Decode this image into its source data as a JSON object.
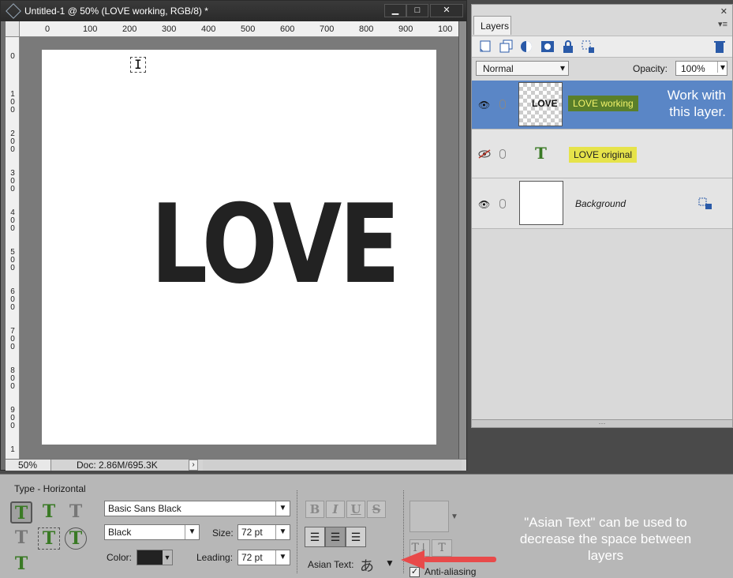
{
  "document": {
    "title": "Untitled-1 @ 50% (LOVE working, RGB/8) *",
    "canvas_text": "LOVE",
    "window_buttons": [
      "▁",
      "□",
      "✕"
    ],
    "ruler_h": [
      "0",
      "100",
      "200",
      "300",
      "400",
      "500",
      "600",
      "700",
      "800",
      "900",
      "100"
    ],
    "ruler_v": [
      "0",
      "1\n0\n0",
      "2\n0\n0",
      "3\n0\n0",
      "4\n0\n0",
      "5\n0\n0",
      "6\n0\n0",
      "7\n0\n0",
      "8\n0\n0",
      "9\n0\n0",
      "1"
    ],
    "status": {
      "zoom": "50%",
      "doc_info": "Doc: 2.86M/695.3K",
      "arrow": "›"
    }
  },
  "layers_panel": {
    "tab": "Layers",
    "blend_mode": "Normal",
    "opacity_label": "Opacity:",
    "opacity_value": "100%",
    "layers": [
      {
        "name": "LOVE working",
        "thumb_text": "LOVE",
        "note": "Work with this layer.",
        "visible": true,
        "selected": true
      },
      {
        "name": "LOVE original",
        "thumb_glyph": "T",
        "visible": false
      },
      {
        "name": "Background",
        "visible": true,
        "locked": true
      }
    ]
  },
  "options_bar": {
    "tool_name": "Type - Horizontal",
    "font_family": "Basic Sans Black",
    "font_style": "Black",
    "size_label": "Size:",
    "size_value": "72 pt",
    "color_label": "Color:",
    "color_value": "#222222",
    "leading_label": "Leading:",
    "leading_value": "72 pt",
    "style_buttons": [
      "B",
      "I",
      "U",
      "S"
    ],
    "asian_text_label": "Asian Text:",
    "anti_aliasing_label": "Anti-aliasing",
    "anti_aliasing_checked": true,
    "annotation": "\"Asian Text\" can be used to decrease the space between layers"
  },
  "colors": {
    "selected_layer": "#5a86c6",
    "working_tag_bg": "#5a7f2a",
    "original_tag_bg": "#e6e34a",
    "annotation_arrow": "#e84a4a"
  }
}
